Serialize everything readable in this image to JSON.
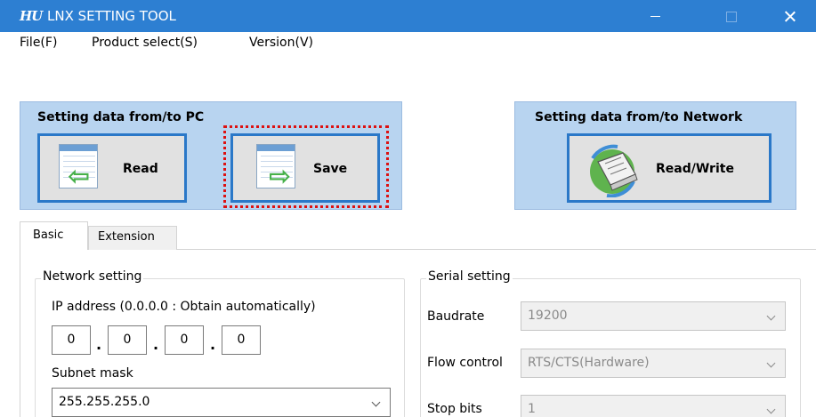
{
  "window": {
    "logo_text": "HU",
    "title": "LNX SETTING TOOL"
  },
  "menu": {
    "file": "File(F)",
    "product_select": "Product select(S)",
    "version": "Version(V)"
  },
  "pc_panel": {
    "title": "Setting data from/to PC",
    "read_label": "Read",
    "save_label": "Save"
  },
  "network_panel": {
    "title": "Setting data from/to Network",
    "readwrite_label": "Read/Write"
  },
  "tabs": {
    "basic": "Basic",
    "extension": "Extension"
  },
  "network_setting": {
    "group_label": "Network setting",
    "ip_label": "IP address (0.0.0.0 : Obtain automatically)",
    "ip_octets": [
      "0",
      "0",
      "0",
      "0"
    ],
    "dot": ".",
    "subnet_label": "Subnet mask",
    "subnet_value": "255.255.255.0"
  },
  "serial_setting": {
    "group_label": "Serial setting",
    "baudrate_label": "Baudrate",
    "baudrate_value": "19200",
    "flow_label": "Flow control",
    "flow_value": "RTS/CTS(Hardware)",
    "stopbits_label": "Stop bits",
    "stopbits_value": "1"
  },
  "colors": {
    "titlebar": "#2d7fd2",
    "panel_bg": "#b8d4f0",
    "button_border": "#2a78c8",
    "focus_dots": "#dd1111",
    "arrow_green": "#46b04a"
  }
}
